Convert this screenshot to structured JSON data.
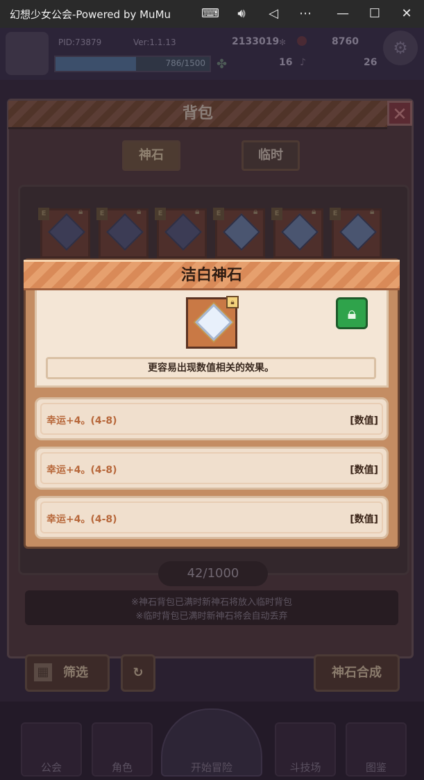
{
  "window": {
    "title": "幻想少女公会-Powered by MuMu"
  },
  "hud": {
    "pid": "PID:73879",
    "version": "Ver:1.1.13",
    "gold": "2133019",
    "gems": "8760",
    "exp_text": "786/1500",
    "exp_fraction": 0.524,
    "resource_a": "16",
    "resource_b": "26"
  },
  "bag": {
    "title": "背包",
    "tabs": [
      "神石",
      "临时"
    ],
    "slot_tag": "E",
    "count": "42/1000",
    "notice": [
      "※神石背包已满时新神石将放入临时背包",
      "※临时背包已满时新神石将会自动丢弃"
    ],
    "filter_label": "筛选",
    "synthesize_label": "神石合成"
  },
  "nav": {
    "items": [
      "公会",
      "角色",
      "开始冒险",
      "斗技场",
      "图鉴"
    ]
  },
  "popup": {
    "title": "洁白神石",
    "description": "更容易出现数值相关的效果。",
    "stats": [
      {
        "text": "幸运+4。(4-8)",
        "tag": "[数值]"
      },
      {
        "text": "幸运+4。(4-8)",
        "tag": "[数值]"
      },
      {
        "text": "幸运+4。(4-8)",
        "tag": "[数值]"
      }
    ]
  }
}
